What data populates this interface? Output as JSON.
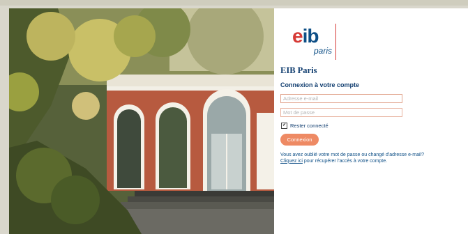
{
  "brand": {
    "logo_text": "eib",
    "logo_sub": "paris",
    "org_name": "EIB Paris"
  },
  "login": {
    "heading": "Connexion à votre compte",
    "email_placeholder": "Adresse e-mail",
    "password_placeholder": "Mot de passe",
    "remember_label": "Rester connecté",
    "remember_checked": true,
    "submit_label": "Connexion",
    "help_line1": "Vous avez oublié votre mot de passe ou changé d'adresse e-mail?",
    "help_link": "Cliquez ici",
    "help_line2": " pour récupérer l'accès à votre compte."
  },
  "colors": {
    "brand_blue": "#103d6f",
    "brand_red": "#d63a36",
    "button": "#ee8a64"
  },
  "photo": {
    "icon": "building-photo"
  }
}
